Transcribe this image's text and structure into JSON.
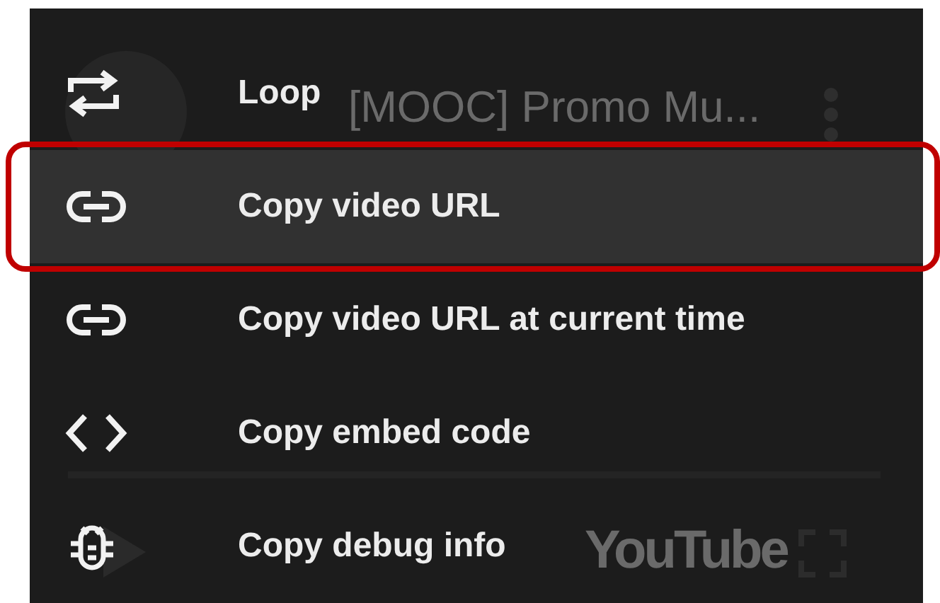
{
  "player": {
    "title": "[MOOC] Promo Mu...",
    "logo_text": "YouTube"
  },
  "menu": [
    {
      "kind": "loop",
      "label": "Loop",
      "selected": false
    },
    {
      "kind": "link",
      "label": "Copy video URL",
      "selected": true
    },
    {
      "kind": "link",
      "label": "Copy video URL at current time",
      "selected": false
    },
    {
      "kind": "code",
      "label": "Copy embed code",
      "selected": false
    },
    {
      "kind": "bug",
      "label": "Copy debug info",
      "selected": false
    }
  ]
}
